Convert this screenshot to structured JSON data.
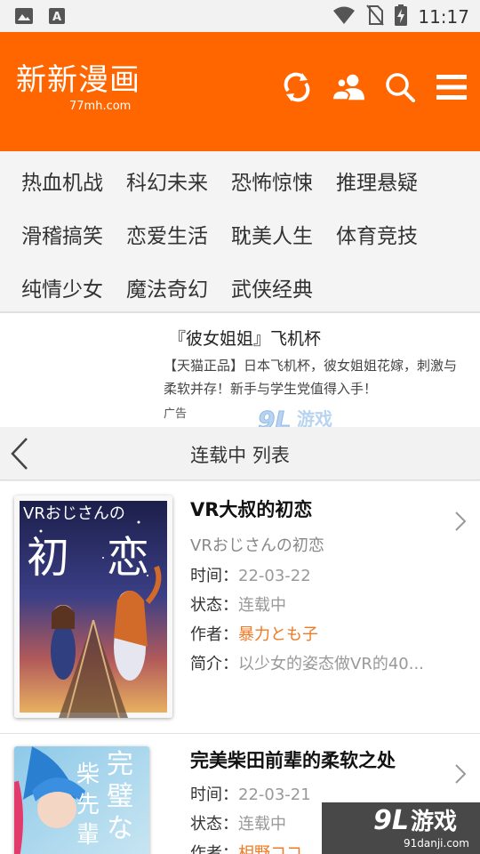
{
  "statusbar": {
    "time": "11:17",
    "left_icons": [
      "image-icon",
      "text-a-icon"
    ],
    "right_icons": [
      "wifi-icon",
      "no-sim-icon",
      "battery-charging-icon"
    ]
  },
  "header": {
    "logo_text": "新新漫画",
    "logo_subtext": "77mh.com",
    "icons": [
      "refresh-icon",
      "user-group-icon",
      "search-icon",
      "menu-icon"
    ],
    "background": "#ff6600"
  },
  "categories": [
    "热血机战",
    "科幻未来",
    "恐怖惊悚",
    "推理悬疑",
    "滑稽搞笑",
    "恋爱生活",
    "耽美人生",
    "体育竞技",
    "纯情少女",
    "魔法奇幻",
    "武侠经典"
  ],
  "ad": {
    "title": "『彼女姐姐』飞机杯",
    "description": "【天猫正品】日本飞机杯，彼女姐姐花嫁，刺激与柔软并存！新手与学生党值得入手！",
    "tag": "广告",
    "logo_text": "游戏",
    "logo_mark": "9L",
    "logo_url": "91danji.com"
  },
  "list_header": {
    "title": "连载中 列表"
  },
  "comics": [
    {
      "title": "VR大叔的初恋",
      "subtitle": "VRおじさんの初恋",
      "time_label": "时间：",
      "time": "22-03-22",
      "status_label": "状态：",
      "status": "连载中",
      "author_label": "作者：",
      "author": "暴力とも子",
      "intro_label": "简介：",
      "intro": "以少女的姿态做VR的40...",
      "cover_text": [
        "VRおじさんの",
        "初",
        "恋"
      ]
    },
    {
      "title": "完美柴田前辈的柔软之处",
      "time_label": "时间：",
      "time": "22-03-21",
      "status_label": "状态：",
      "status": "连载中",
      "author_label": "作者：",
      "author": "相野ココ",
      "cover_text": [
        "完",
        "璧",
        "な",
        "柴",
        "先",
        "輩"
      ]
    }
  ],
  "watermark": {
    "mark": "9L",
    "text": "游戏",
    "url": "91danji.com"
  }
}
